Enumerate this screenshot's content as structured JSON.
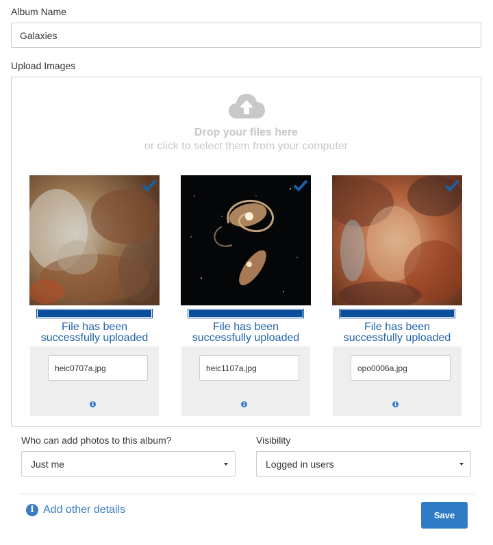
{
  "album_name": {
    "label": "Album Name",
    "value": "Galaxies"
  },
  "upload": {
    "label": "Upload Images",
    "drop_title": "Drop your files here",
    "drop_subtitle": "or click to select them from your computer",
    "icon": "cloud-upload-icon",
    "files": [
      {
        "status": "File has been\nsuccessfully uploaded",
        "filename": "heic0707a.jpg",
        "progress": 1.0,
        "uploaded": true
      },
      {
        "status": "File has been\nsuccessfully uploaded",
        "filename": "heic1107a.jpg",
        "progress": 1.0,
        "uploaded": true
      },
      {
        "status": "File has been\nsuccessfully uploaded",
        "filename": "opo0006a.jpg",
        "progress": 1.0,
        "uploaded": true
      }
    ]
  },
  "permissions": {
    "label": "Who can add photos to this album?",
    "selected": "Just me"
  },
  "visibility": {
    "label": "Visibility",
    "selected": "Logged in users"
  },
  "footer": {
    "details_link": "Add other details",
    "save_label": "Save"
  },
  "colors": {
    "accent": "#2f7bc4",
    "progress": "#0b4f9c",
    "status_text": "#1f63a8",
    "checkmark": "#1a5fa8"
  }
}
